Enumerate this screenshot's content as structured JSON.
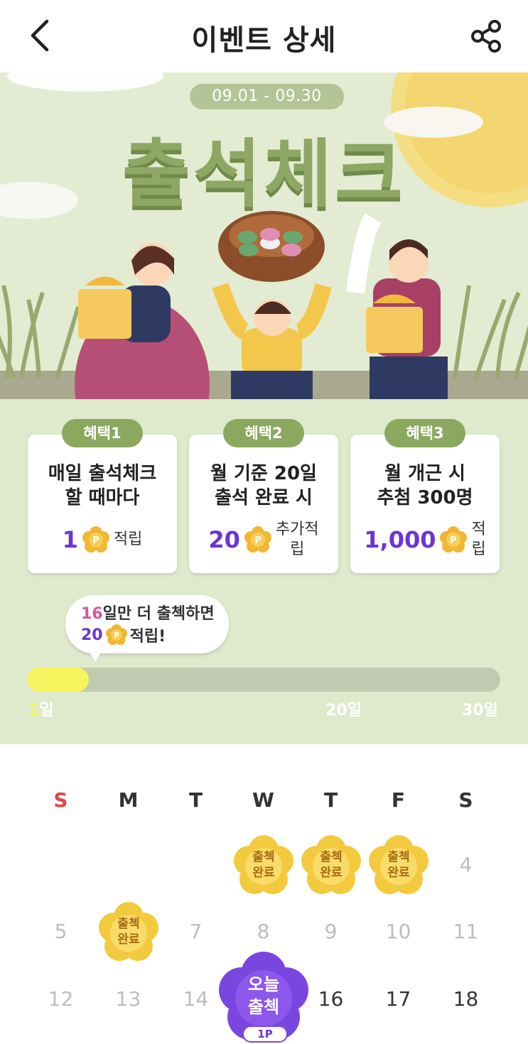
{
  "header": {
    "title": "이벤트 상세",
    "back_icon": "chevron-left-icon",
    "share_icon": "share-icon"
  },
  "banner": {
    "date_range": "09.01 - 09.30",
    "title": "출석체크"
  },
  "benefits": [
    {
      "tag": "혜택1",
      "line1": "매일 출석체크",
      "line2": "할 때마다",
      "amount": "1",
      "unit": "적립"
    },
    {
      "tag": "혜택2",
      "line1": "월 기준 20일",
      "line2": "출석 완료 시",
      "amount": "20",
      "unit1": "추가적",
      "unit2": "립"
    },
    {
      "tag": "혜택3",
      "line1": "월 개근 시",
      "line2": "추첨 300명",
      "amount": "1,000",
      "unit1": "적",
      "unit2": "립"
    }
  ],
  "coin_label": "P",
  "bubble": {
    "days": "16",
    "line1_rest": "일만 더 출첵하면",
    "points": "20",
    "line2_rest": "적립!"
  },
  "progress": {
    "current": 1,
    "total": 30,
    "label_start_num": "1",
    "label_start_unit": "일",
    "label_mid": "20일",
    "label_end": "30일"
  },
  "colors": {
    "accent_purple": "#6b35d6",
    "banner_green": "#8ea764",
    "progress_yellow": "#f7f55f",
    "sunday_red": "#e04848"
  },
  "calendar": {
    "weekdays": [
      "S",
      "M",
      "T",
      "W",
      "T",
      "F",
      "S"
    ],
    "stamp_line1": "출첵",
    "stamp_line2": "완료",
    "today_line1": "오늘",
    "today_line2": "출첵",
    "today_points": "1P",
    "week1": {
      "sat": "4"
    },
    "week2": [
      "5",
      "7",
      "8",
      "9",
      "10",
      "11"
    ],
    "week3": [
      "12",
      "13",
      "14",
      "16",
      "17",
      "18"
    ]
  }
}
